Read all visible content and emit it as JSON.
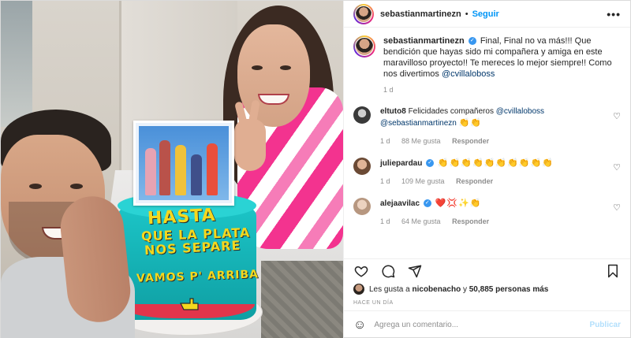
{
  "header": {
    "username": "sebastianmartinezn",
    "separator": "•",
    "follow_label": "Seguir",
    "more_icon": "more-options-icon"
  },
  "caption": {
    "username": "sebastianmartinezn",
    "text": "Final, Final no va más!!! Que bendición que hayas sido mi compañera y amiga en este maravilloso proyecto!! Te mereces lo mejor siempre!! Como nos divertimos",
    "mention": "@cvillaloboss",
    "time": "1 d"
  },
  "comments": [
    {
      "username": "eltuto8",
      "text": "Felicidades compañeros",
      "mention1": "@cvillaloboss",
      "mention2": "@sebastianmartinezn",
      "emoji": "👏👏",
      "time": "1 d",
      "likes": "88 Me gusta",
      "reply": "Responder",
      "avatar_color": "#3a3a3a"
    },
    {
      "username": "juliepardau",
      "text": "👏👏👏👏👏👏👏👏👏👏",
      "time": "1 d",
      "likes": "109 Me gusta",
      "reply": "Responder",
      "avatar_color": "#c88f6f"
    },
    {
      "username": "alejaavilac",
      "text": "❤️💢✨👏",
      "time": "1 d",
      "likes": "64 Me gusta",
      "reply": "Responder",
      "avatar_color": "#d7b9a4"
    }
  ],
  "actions": {
    "like_icon": "heart-icon",
    "comment_icon": "comment-icon",
    "share_icon": "share-icon",
    "save_icon": "bookmark-icon"
  },
  "likes": {
    "prefix": "Les gusta a",
    "user": "nicobenacho",
    "middle": "y",
    "count": "50,885 personas más"
  },
  "time_ago": "HACE UN DÍA",
  "add_comment": {
    "placeholder": "Agrega un comentario...",
    "publish_label": "Publicar"
  },
  "cake": {
    "line1": "HASTA",
    "line2": "QUE LA PLATA",
    "line3": "NOS SEPARE",
    "line4": "VAMOS P' ARRIBA"
  },
  "colors": {
    "accent": "#0095f6",
    "publish_disabled": "#b2dffc",
    "verified": "#3897f0",
    "muted": "#8e8e8e"
  }
}
